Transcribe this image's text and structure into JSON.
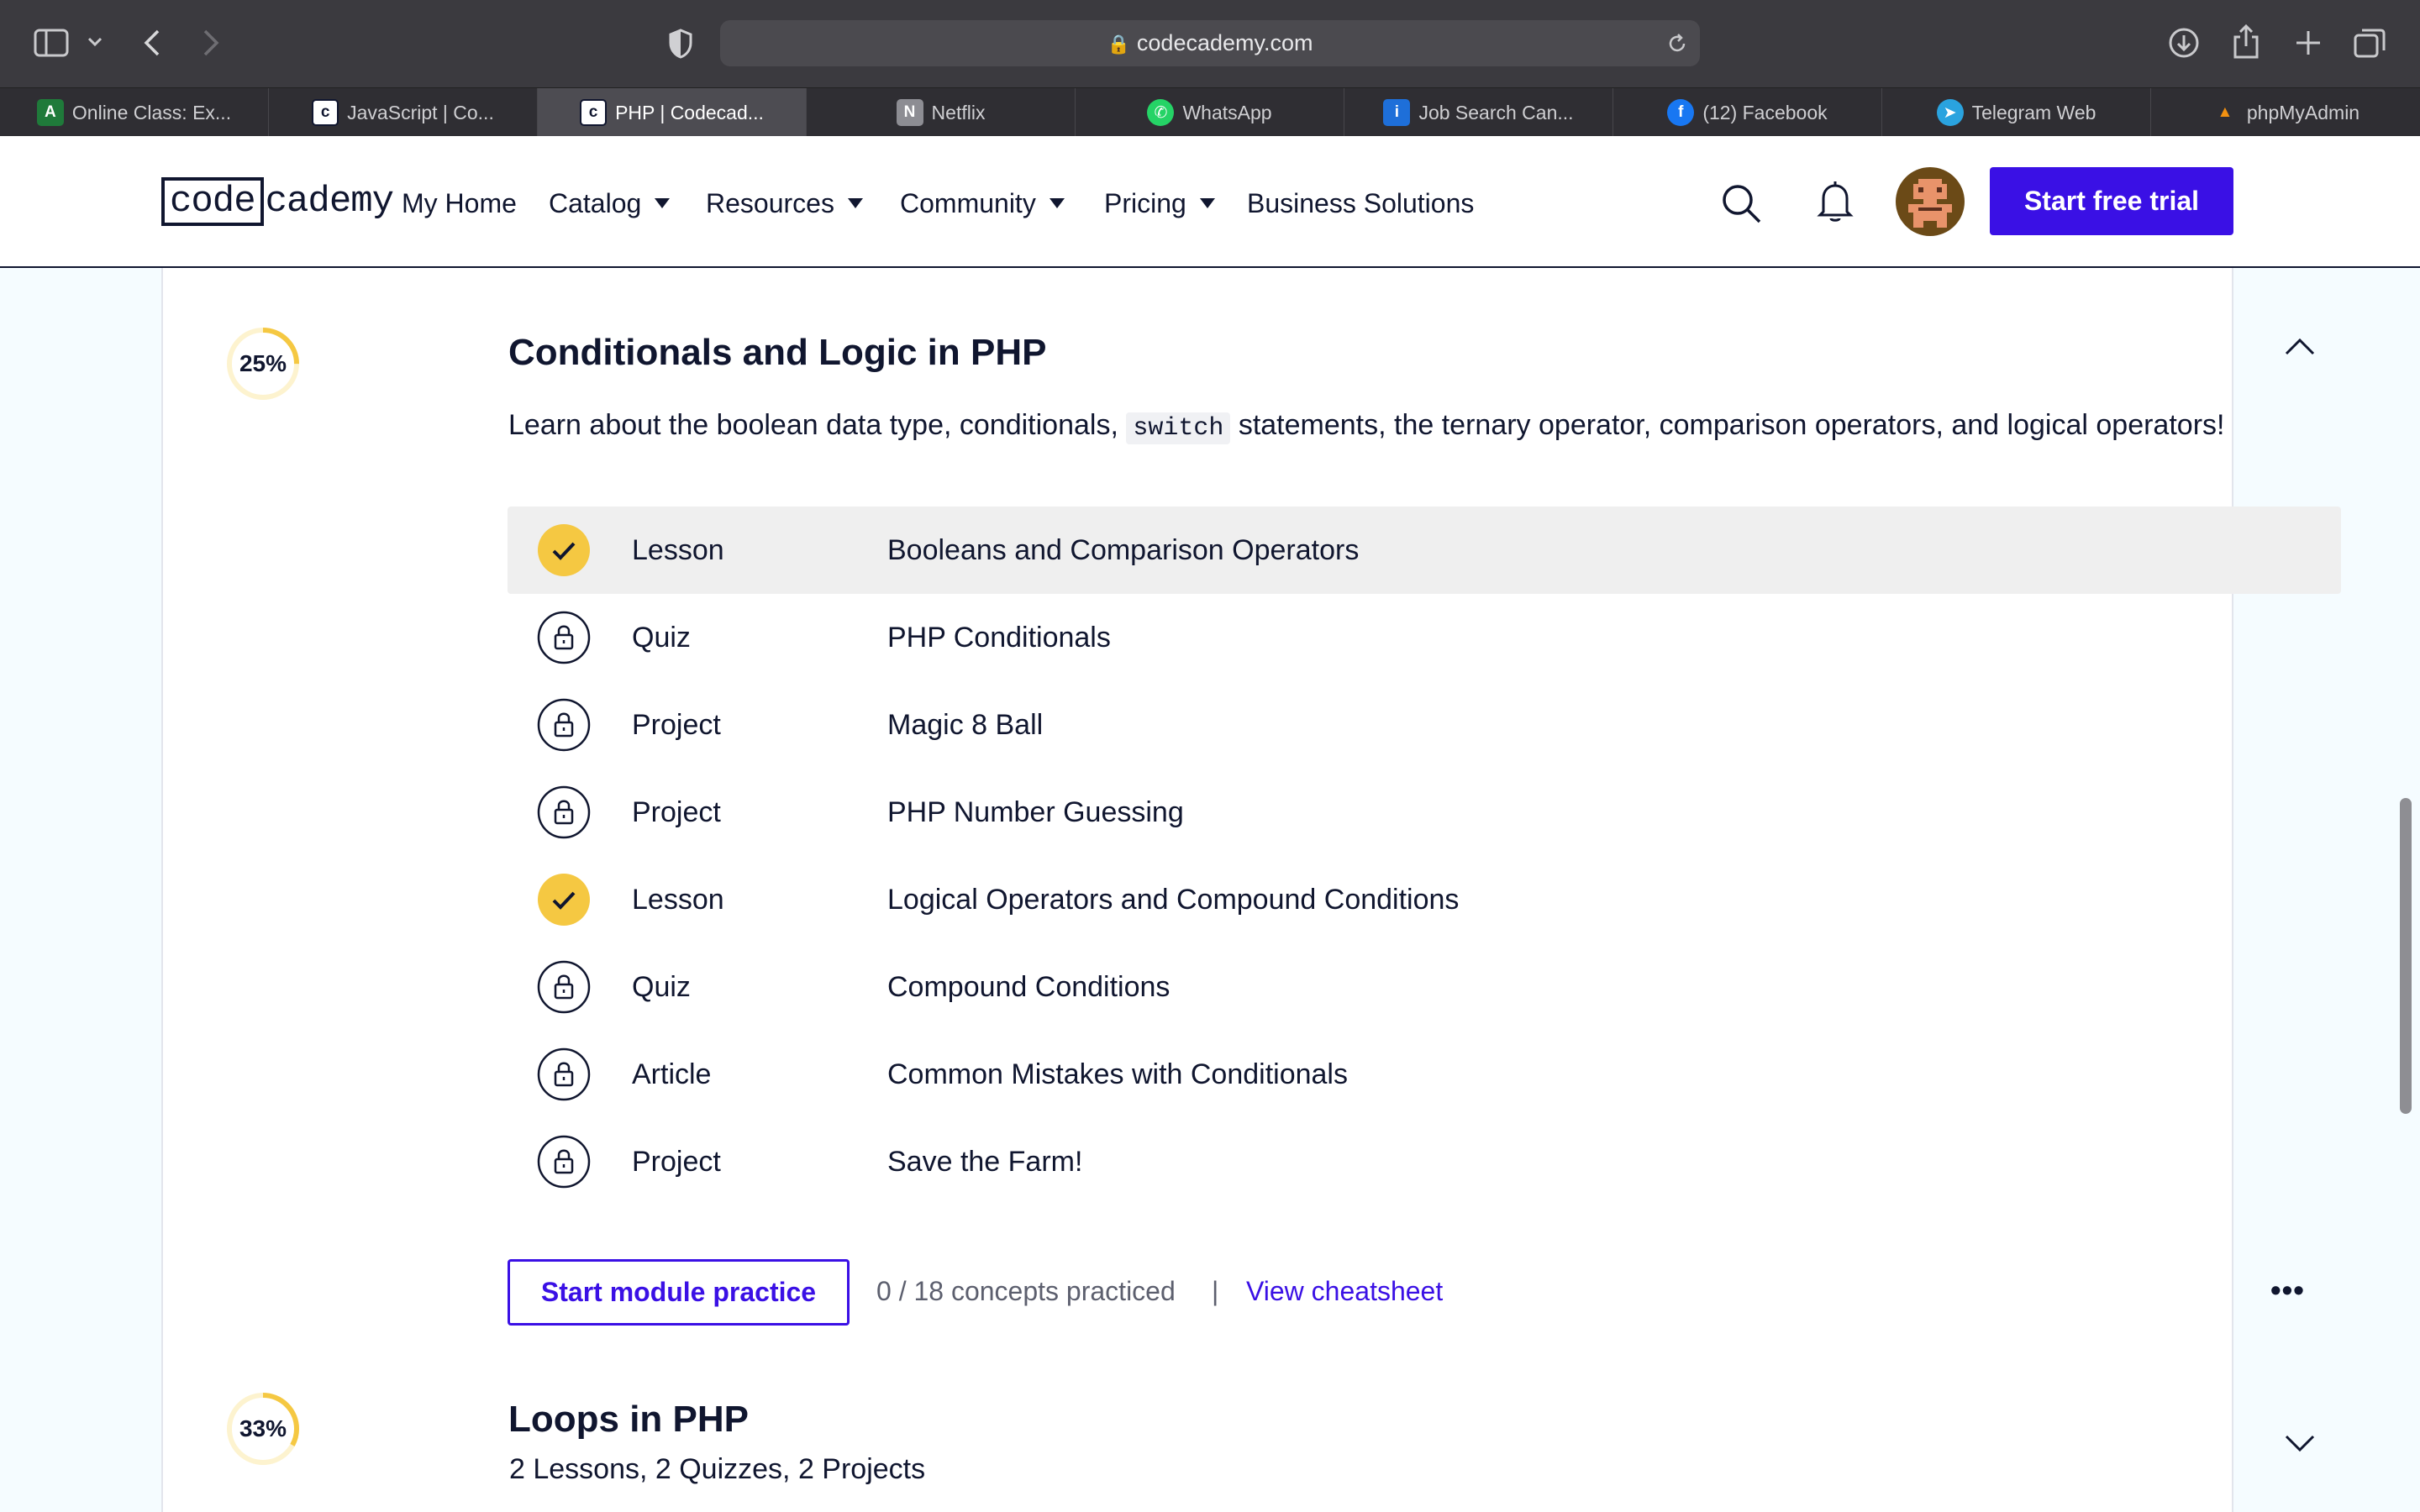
{
  "browser": {
    "url": "codecademy.com",
    "tabs": [
      {
        "label": "Online Class: Ex...",
        "icon": "A",
        "color": "#1f7a3a"
      },
      {
        "label": "JavaScript | Co...",
        "icon": "c",
        "color": "#ffffff"
      },
      {
        "label": "PHP | Codecad...",
        "icon": "c",
        "color": "#ffffff",
        "active": true
      },
      {
        "label": "Netflix",
        "icon": "N",
        "color": "#8d8d93"
      },
      {
        "label": "WhatsApp",
        "icon": "W",
        "color": "#25d366"
      },
      {
        "label": "Job Search Can...",
        "icon": "i",
        "color": "#1e6fd9"
      },
      {
        "label": "(12) Facebook",
        "icon": "f",
        "color": "#1877f2"
      },
      {
        "label": "Telegram Web",
        "icon": "t",
        "color": "#2aa3df"
      },
      {
        "label": "phpMyAdmin",
        "icon": "p",
        "color": "#f29111"
      }
    ]
  },
  "nav": {
    "logo_box": "code",
    "logo_rest": "cademy",
    "my_home": "My Home",
    "catalog": "Catalog",
    "resources": "Resources",
    "community": "Community",
    "pricing": "Pricing",
    "business": "Business Solutions",
    "cta": "Start free trial"
  },
  "module1": {
    "progress_label": "25%",
    "progress": 0.25,
    "title": "Conditionals and Logic in PHP",
    "desc_before": "Learn about the boolean data type, conditionals,",
    "desc_code": "switch",
    "desc_after": "statements, the ternary operator, comparison operators, and logical operators!",
    "items": [
      {
        "type": "Lesson",
        "name": "Booleans and Comparison Operators",
        "status": "done"
      },
      {
        "type": "Quiz",
        "name": "PHP Conditionals",
        "status": "locked"
      },
      {
        "type": "Project",
        "name": "Magic 8 Ball",
        "status": "locked"
      },
      {
        "type": "Project",
        "name": "PHP Number Guessing",
        "status": "locked"
      },
      {
        "type": "Lesson",
        "name": "Logical Operators and Compound Conditions",
        "status": "done"
      },
      {
        "type": "Quiz",
        "name": "Compound Conditions",
        "status": "locked"
      },
      {
        "type": "Article",
        "name": "Common Mistakes with Conditionals",
        "status": "locked"
      },
      {
        "type": "Project",
        "name": "Save the Farm!",
        "status": "locked"
      }
    ],
    "practice_button": "Start module practice",
    "concepts": "0 / 18 concepts practiced",
    "separator": "|",
    "cheatsheet": "View cheatsheet",
    "more": "•••"
  },
  "module2": {
    "progress_label": "33%",
    "progress": 0.33,
    "title": "Loops in PHP",
    "summary": "2 Lessons, 2 Quizzes, 2 Projects"
  },
  "colors": {
    "accent": "#3a10e5",
    "navy": "#10162f",
    "done": "#f5c842",
    "ring_track": "#fdf3cf"
  }
}
